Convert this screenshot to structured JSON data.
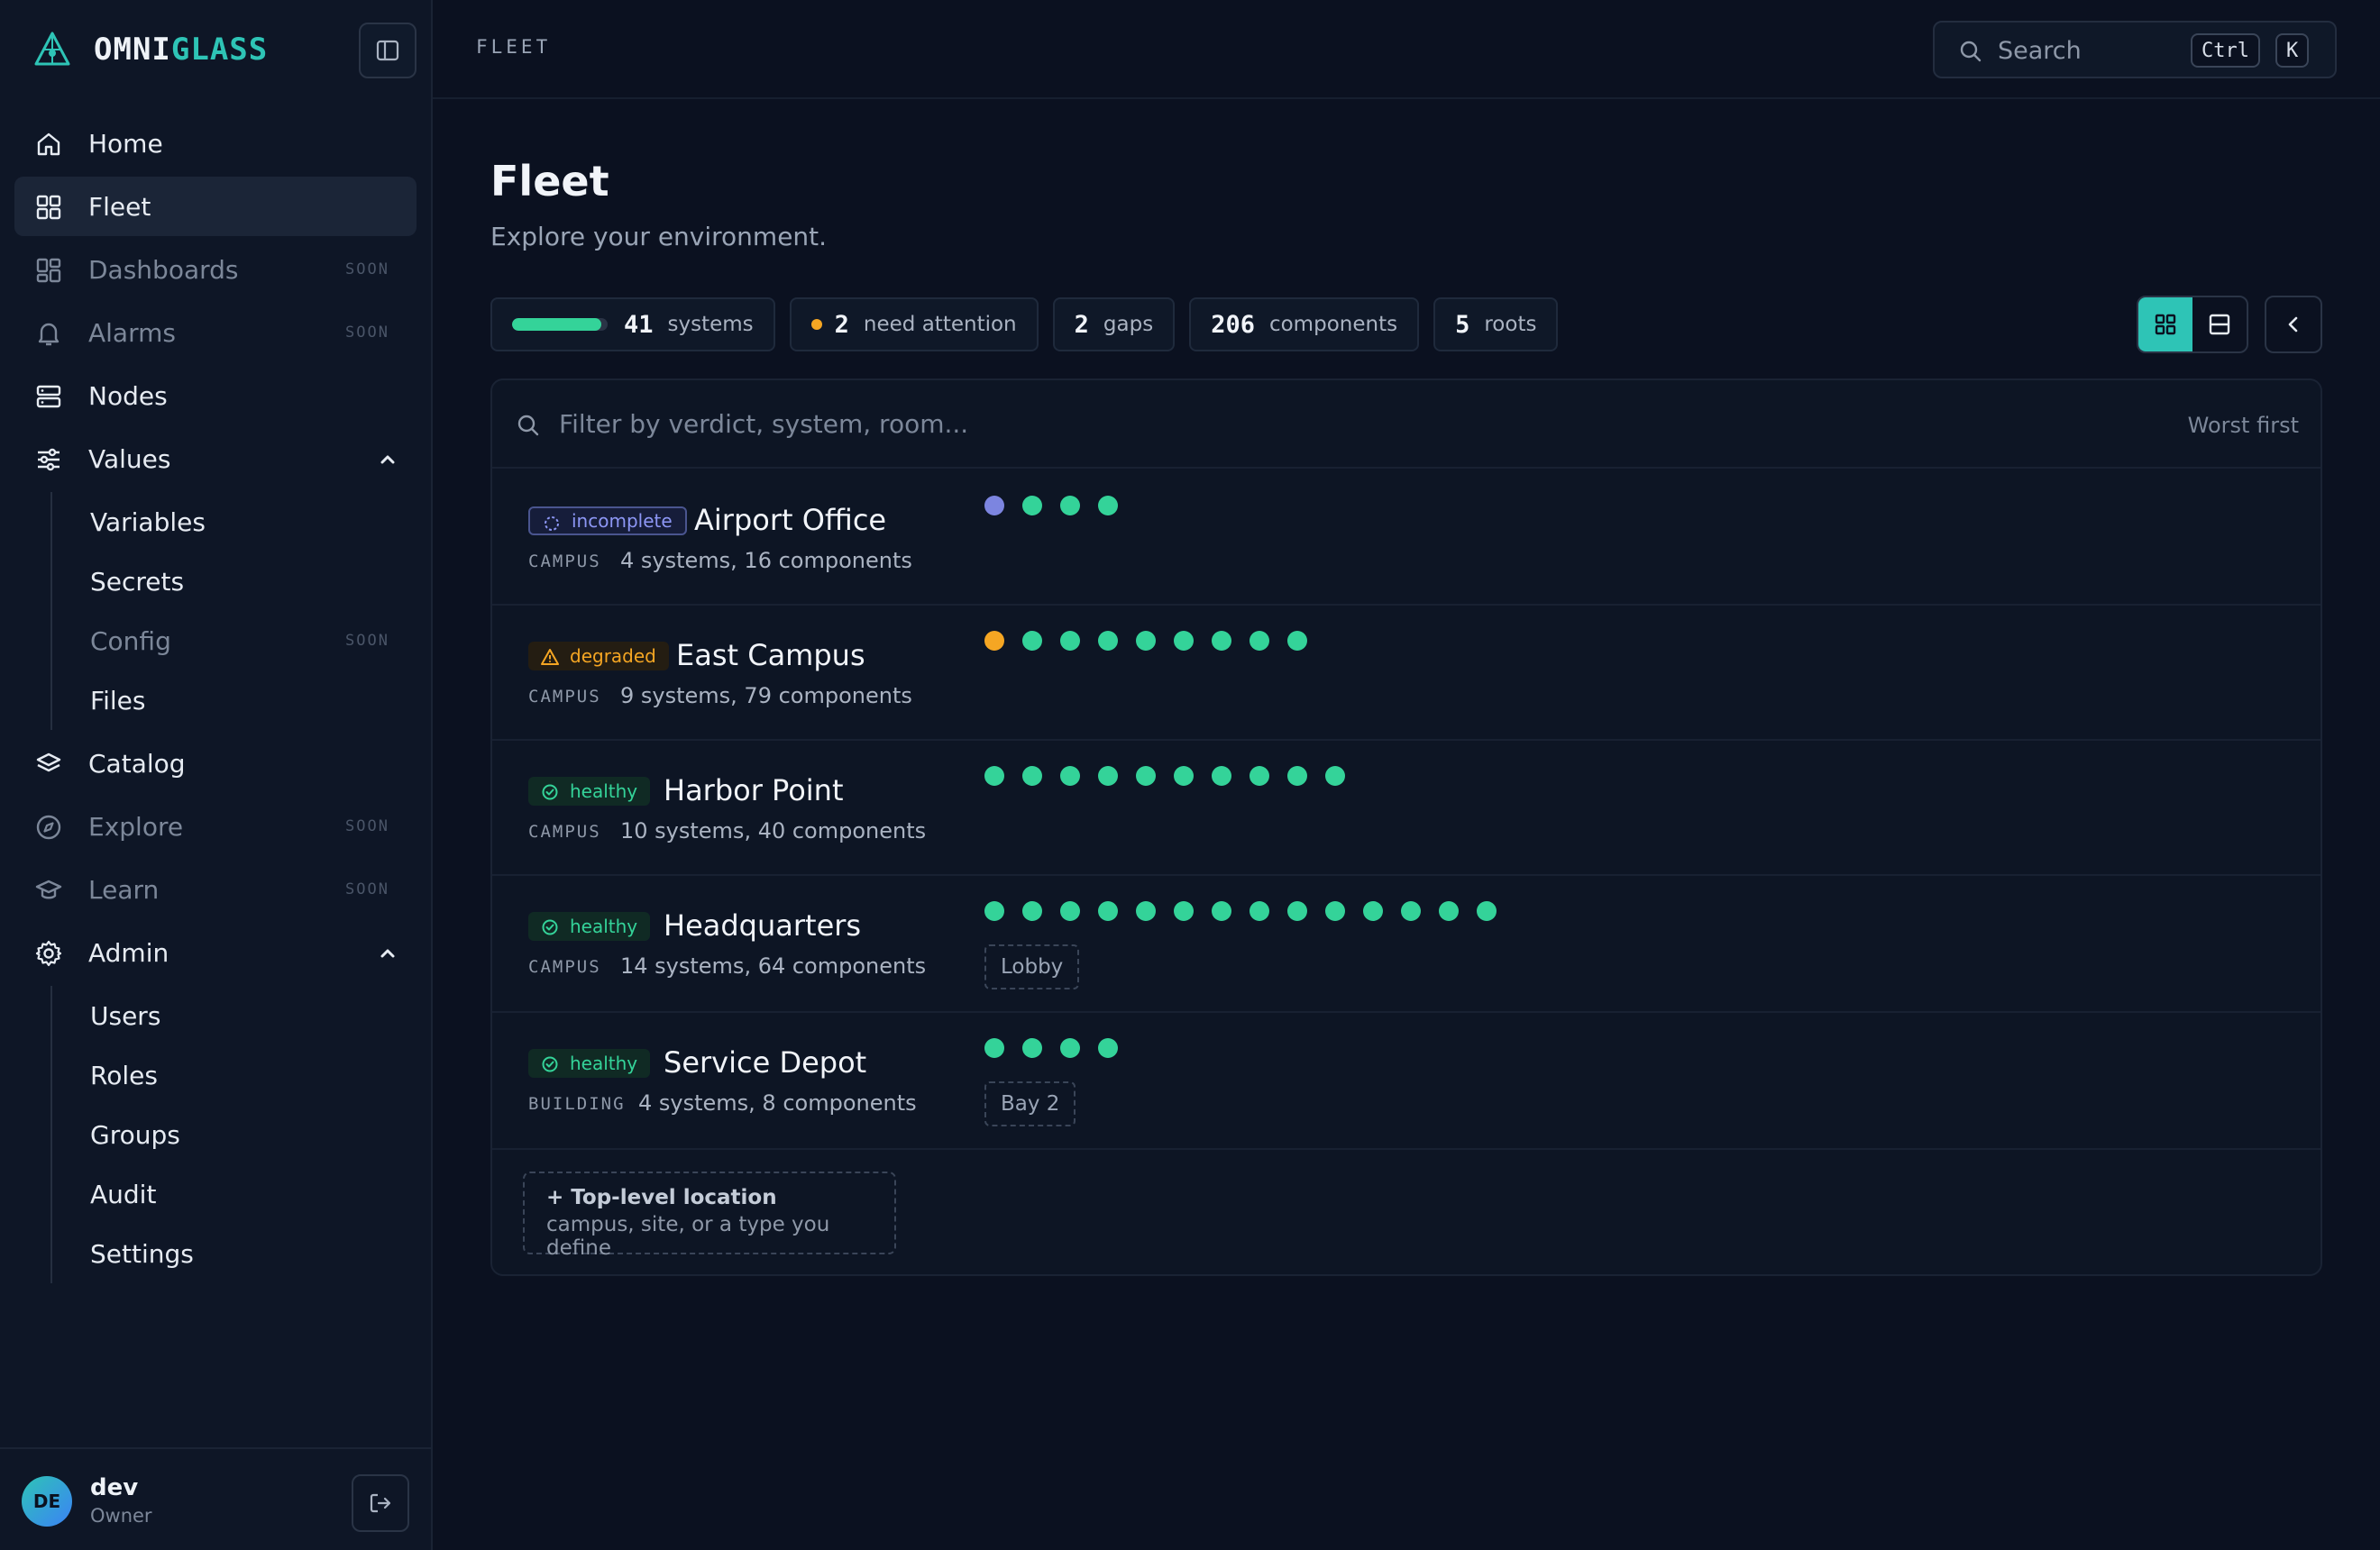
{
  "brand": {
    "name_a": "OMNI",
    "name_b": "GLASS"
  },
  "sidebar": {
    "items": [
      {
        "label": "Home",
        "soon": ""
      },
      {
        "label": "Fleet",
        "soon": ""
      },
      {
        "label": "Dashboards",
        "soon": "SOON"
      },
      {
        "label": "Alarms",
        "soon": "SOON"
      },
      {
        "label": "Nodes",
        "soon": ""
      },
      {
        "label": "Values",
        "soon": ""
      },
      {
        "label": "Catalog",
        "soon": ""
      },
      {
        "label": "Explore",
        "soon": "SOON"
      },
      {
        "label": "Learn",
        "soon": "SOON"
      },
      {
        "label": "Admin",
        "soon": ""
      }
    ],
    "values_sub": [
      {
        "label": "Variables",
        "soon": ""
      },
      {
        "label": "Secrets",
        "soon": ""
      },
      {
        "label": "Config",
        "soon": "SOON"
      },
      {
        "label": "Files",
        "soon": ""
      }
    ],
    "admin_sub": [
      {
        "label": "Users"
      },
      {
        "label": "Roles"
      },
      {
        "label": "Groups"
      },
      {
        "label": "Audit"
      },
      {
        "label": "Settings"
      }
    ],
    "user": {
      "initials": "DE",
      "name": "dev",
      "role": "Owner"
    }
  },
  "topbar": {
    "breadcrumb": "FLEET",
    "search_placeholder": "Search",
    "shortcut_ctrl": "Ctrl",
    "shortcut_key": "K"
  },
  "main": {
    "title": "Fleet",
    "subtitle": "Explore your environment.",
    "stats": {
      "systems_num": "41",
      "systems_label": "systems",
      "systems_healthy_fraction": 0.93,
      "attention_num": "2",
      "attention_label": "need attention",
      "gaps_num": "2",
      "gaps_label": "gaps",
      "components_num": "206",
      "components_label": "components",
      "roots_num": "5",
      "roots_label": "roots"
    },
    "filter_placeholder": "Filter by verdict, system, room...",
    "sort_label": "Worst first",
    "rows": [
      {
        "verdict": "incomplete",
        "name": "Airport Office",
        "type": "CAMPUS",
        "meta": "4 systems, 16 components",
        "dots": [
          "incomplete",
          "healthy",
          "healthy",
          "healthy"
        ],
        "tag": ""
      },
      {
        "verdict": "degraded",
        "name": "East Campus",
        "type": "CAMPUS",
        "meta": "9 systems, 79 components",
        "dots": [
          "degraded",
          "healthy",
          "healthy",
          "healthy",
          "healthy",
          "healthy",
          "healthy",
          "healthy",
          "healthy"
        ],
        "tag": ""
      },
      {
        "verdict": "healthy",
        "name": "Harbor Point",
        "type": "CAMPUS",
        "meta": "10 systems, 40 components",
        "dots": [
          "healthy",
          "healthy",
          "healthy",
          "healthy",
          "healthy",
          "healthy",
          "healthy",
          "healthy",
          "healthy",
          "healthy"
        ],
        "tag": ""
      },
      {
        "verdict": "healthy",
        "name": "Headquarters",
        "type": "CAMPUS",
        "meta": "14 systems, 64 components",
        "dots": [
          "healthy",
          "healthy",
          "healthy",
          "healthy",
          "healthy",
          "healthy",
          "healthy",
          "healthy",
          "healthy",
          "healthy",
          "healthy",
          "healthy",
          "healthy",
          "healthy"
        ],
        "tag": "Lobby"
      },
      {
        "verdict": "healthy",
        "name": "Service Depot",
        "type": "BUILDING",
        "meta": "4 systems, 8 components",
        "dots": [
          "healthy",
          "healthy",
          "healthy",
          "healthy"
        ],
        "tag": "Bay 2"
      }
    ],
    "add_location": {
      "title": "+ Top-level location",
      "hint": "campus, site, or a type you define"
    }
  },
  "colors": {
    "accent": "#2ec4b6",
    "healthy": "#34d399",
    "degraded": "#f5a623",
    "incomplete": "#7c85e0"
  }
}
